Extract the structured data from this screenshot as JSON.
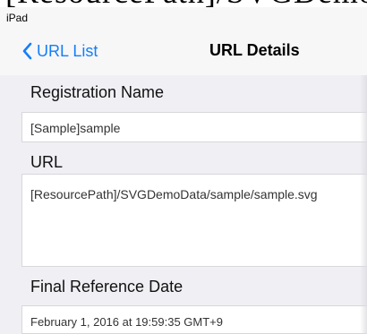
{
  "status_bar": {
    "device_label": "iPad"
  },
  "navigation": {
    "back_label": "URL List",
    "title": "URL Details"
  },
  "registration_name": {
    "label": "Registration Name",
    "value": "[Sample]sample"
  },
  "url": {
    "label": "URL",
    "value": "[ResourcePath]/SVGDemoData/sample/sample.svg"
  },
  "final_reference_date": {
    "label": "Final Reference Date",
    "value": "February 1, 2016 at 19:59:35 GMT+9"
  },
  "colors": {
    "accent": "#147efb",
    "navigation_background": "#f7f7f7",
    "content_background": "#efeff4",
    "field_background": "#ffffff"
  },
  "icons": {
    "back": "chevron-left-icon"
  }
}
